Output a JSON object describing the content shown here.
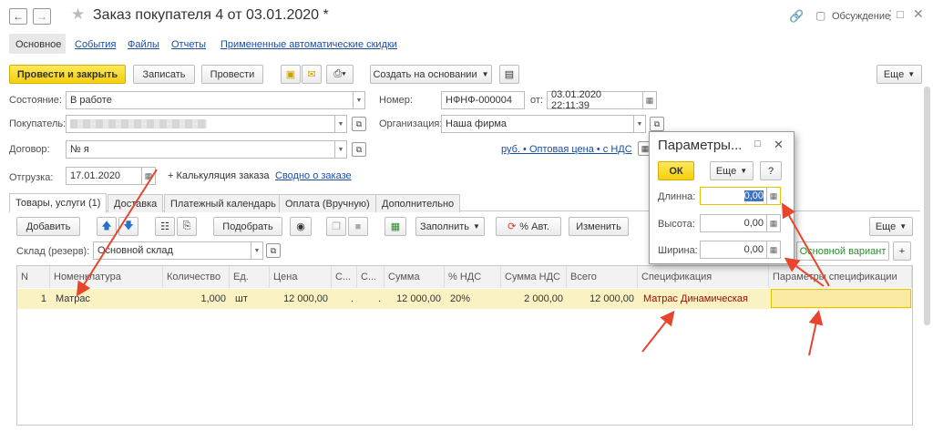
{
  "window": {
    "title": "Заказ покупателя 4 от 03.01.2020 *",
    "discussion_label": "Обсуждение"
  },
  "nav_tabs": [
    "Основное",
    "События",
    "Файлы",
    "Отчеты",
    "Примененные автоматические скидки"
  ],
  "toolbar": {
    "post_close": "Провести и закрыть",
    "save": "Записать",
    "post": "Провести",
    "create_basis": "Создать на основании",
    "more": "Еще"
  },
  "form": {
    "state_label": "Состояние:",
    "state_value": "В работе",
    "buyer_label": "Покупатель:",
    "contract_label": "Договор:",
    "contract_value": "№ я",
    "shipment_label": "Отгрузка:",
    "shipment_value": "17.01.2020",
    "calc_label": "+ Калькуляция заказа",
    "summary_link": "Сводно о заказе",
    "number_label": "Номер:",
    "number_value": "НФНФ-000004",
    "from_label": "от:",
    "date_value": "03.01.2020 22:11:39",
    "org_label": "Организация:",
    "org_value": "Наша фирма",
    "price_link": "руб. • Оптовая цена • с НДС"
  },
  "doc_tabs": [
    "Товары, услуги (1)",
    "Доставка",
    "Платежный календарь",
    "Оплата (Вручную)",
    "Дополнительно"
  ],
  "table_toolbar": {
    "add": "Добавить",
    "select": "Подобрать",
    "fill": "Заполнить",
    "auto_pct": "% Авт.",
    "change": "Изменить",
    "more": "Еще",
    "warehouse_label": "Склад (резерв):",
    "warehouse_value": "Основной склад",
    "variant": "Основной вариант"
  },
  "table": {
    "headers": [
      "N",
      "Номенклатура",
      "Количество",
      "Ед.",
      "Цена",
      "С...",
      "С...",
      "Сумма",
      "% НДС",
      "Сумма НДС",
      "Всего",
      "Спецификация",
      "Параметры спецификации"
    ],
    "row": {
      "n": "1",
      "item": "Матрас",
      "qty": "1,000",
      "unit": "шт",
      "price": "12 000,00",
      "c1": ".",
      "c2": ".",
      "sum": "12 000,00",
      "vat_pct": "20%",
      "vat_sum": "2 000,00",
      "total": "12 000,00",
      "spec": "Матрас Динамическая",
      "spec_params": ""
    }
  },
  "popup": {
    "title": "Параметры...",
    "ok": "ОК",
    "more": "Еще",
    "help": "?",
    "length_label": "Длинна:",
    "length_value": "0,00",
    "height_label": "Высота:",
    "height_value": "0,00",
    "width_label": "Ширина:",
    "width_value": "0,00"
  },
  "colors": {
    "accent_yellow": "#f5cf0c",
    "link_blue": "#1a4ea3",
    "arrow_red": "#e8452c",
    "row_highlight": "#fbf2c4",
    "spec_red": "#b10000",
    "variant_green": "#2e8b2e"
  }
}
